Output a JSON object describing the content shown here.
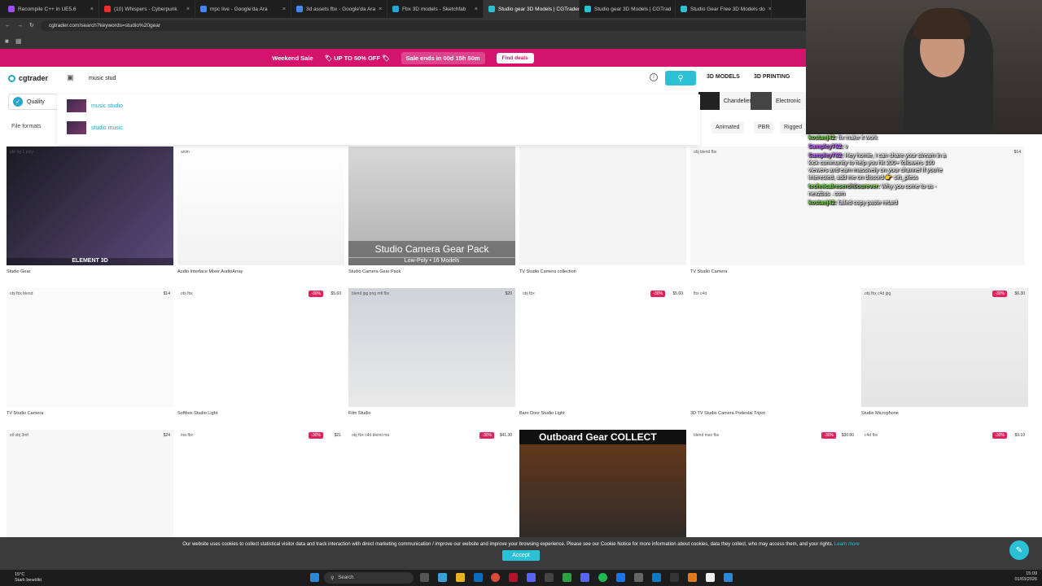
{
  "browser": {
    "tabs": [
      {
        "label": "Recompile C++ in UE5.6",
        "color": "#9b4dff"
      },
      {
        "label": "(10) Whispers - Cyberpunk",
        "color": "#ff2a2a"
      },
      {
        "label": "mpc live - Google'da Ara",
        "color": "#4285f4"
      },
      {
        "label": "3d assets fbx - Google'da Ara",
        "color": "#4285f4"
      },
      {
        "label": "Fbx 3D models - Sketchfab",
        "color": "#1caad9"
      },
      {
        "label": "Studio gear 3D Models | CGTrader",
        "color": "#2bc0d6"
      },
      {
        "label": "Studio gear 3D Models | CGTrad",
        "color": "#2bc0d6"
      },
      {
        "label": "Studio Gear Free 3D Models do",
        "color": "#2bc0d6"
      }
    ],
    "url": "cgtrader.com/search?keywords=studio%20gear"
  },
  "promo": {
    "title": "Weekend Sale",
    "offer": "UP TO 50% OFF",
    "timer": "Sale ends in 00d 15h 50m",
    "cta": "Find deals"
  },
  "header": {
    "logo": "cgtrader",
    "search_value": "music stud",
    "nav": [
      "3D MODELS",
      "3D PRINTING"
    ]
  },
  "suggestions": [
    "music studio",
    "studio music"
  ],
  "filters": {
    "quality": "Quality",
    "chips": [
      "Chandelier",
      "Electronic"
    ],
    "file_formats": "File formats",
    "tags": [
      "Animated",
      "PBR",
      "Rigged"
    ]
  },
  "cards": [
    {
      "title": "Studio Gear",
      "formats": "pbr rig 1 poly",
      "price": "",
      "discount": "",
      "img_label": "ELEMENT 3D"
    },
    {
      "title": "Audio Interface Mixer AudioArray",
      "formats": "anim",
      "price": "",
      "discount": "",
      "img_label": ""
    },
    {
      "title": "Studio Camera Gear Pack",
      "formats": "",
      "price": "",
      "discount": "",
      "img_label": "Studio Camera Gear Pack",
      "img_sub": "Low-Poly • 16 Models"
    },
    {
      "title": "TV Studio Camera collection",
      "formats": "",
      "price": "",
      "discount": "",
      "img_label": ""
    },
    {
      "title": "TV Studio Camera",
      "formats": "obj blend fbx",
      "price": "$14",
      "discount": "",
      "img_label": ""
    },
    {
      "title": "TV Studio Camera",
      "formats": "obj fbx blend",
      "price": "$14",
      "discount": "",
      "img_label": ""
    },
    {
      "title": "Softbox Studio Light",
      "formats": "obj fbx",
      "price": "$5.60",
      "discount": "-30%",
      "img_label": ""
    },
    {
      "title": "Film Studio",
      "formats": "blend jpg png mtl fbx",
      "price": "$20",
      "discount": "",
      "img_label": ""
    },
    {
      "title": "Barn Door Studio Light",
      "formats": "obj fbx",
      "price": "$5.60",
      "discount": "-30%",
      "img_label": ""
    },
    {
      "title": "3D TV Studio Camera Podestal Tripot",
      "formats": "fbx c4d",
      "price": "",
      "discount": "",
      "img_label": ""
    },
    {
      "title": "Studio Microphone",
      "formats": "obj fbx c4d jpg",
      "price": "$6.30",
      "discount": "-30%",
      "img_label": ""
    },
    {
      "title": "",
      "formats": "stl obj 3mf",
      "price": "$24",
      "discount": "",
      "img_label": ""
    },
    {
      "title": "",
      "formats": "ma fbx",
      "price": "$21",
      "discount": "-30%",
      "img_label": ""
    },
    {
      "title": "",
      "formats": "obj fbx c4d blend ma",
      "price": "$41.30",
      "discount": "-30%",
      "img_label": ""
    },
    {
      "title": "",
      "formats": "",
      "price": "$35",
      "discount": "-30%",
      "img_label": "Outboard Gear COLLECT"
    },
    {
      "title": "",
      "formats": "blend max fbx",
      "price": "$30.80",
      "discount": "-30%",
      "img_label": ""
    },
    {
      "title": "",
      "formats": "c4d fbx",
      "price": "$9.10",
      "discount": "-30%",
      "img_label": ""
    }
  ],
  "chat": [
    {
      "user": "kostanj42:",
      "text": "fix make it work",
      "cls": "u2"
    },
    {
      "user": "Sampley762:",
      "text": "v",
      "cls": "u"
    },
    {
      "user": "Sampley762:",
      "text": "Hey homie, I can share your stream in a kick community to help you hit 200+ followers 100 viewers and earn massively on your channel If you're interested, add me on discord 👉 sirt_pless",
      "cls": "u"
    },
    {
      "user": "technicalreserch0ourever:",
      "text": "Why you come to us - nexzbus . com",
      "cls": "u2"
    },
    {
      "user": "kostanj42:",
      "text": "failed copy paste retard",
      "cls": "u2"
    }
  ],
  "cookie": {
    "text": "Our website uses cookies to collect statistical visitor data and track interaction with direct marketing communication / improve our website and improve your browsing experience. Please see our Cookie Notice for more information about cookies, data they collect, who may access them, and your rights.",
    "link": "Learn more",
    "accept": "Accept"
  },
  "taskbar": {
    "weather_temp": "15°C",
    "weather_desc": "Stark bewölkt",
    "search": "Search",
    "time": "15:09",
    "date": "01/03/2026"
  }
}
